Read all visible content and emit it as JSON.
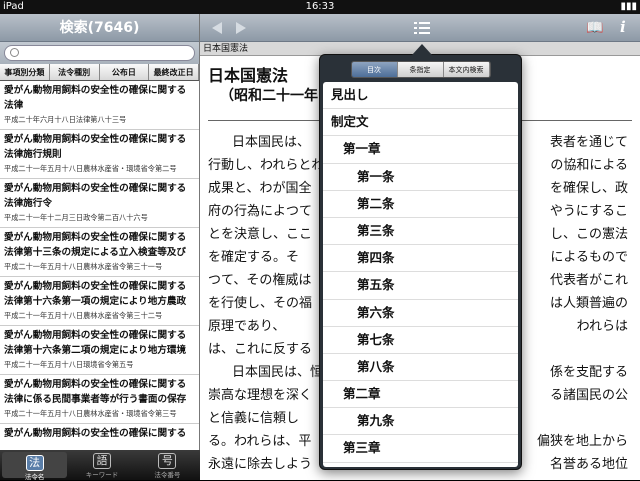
{
  "status": {
    "device": "iPad",
    "time": "16:33",
    "battery": "⎕"
  },
  "left": {
    "title": "検索(7646)",
    "search_placeholder": "",
    "segments": [
      "事項別分類",
      "法令種別",
      "公布日",
      "最終改正日"
    ],
    "items": [
      {
        "title": "愛がん動物用飼料の安全性の確保に関する法律",
        "title2": "",
        "sub": "平成二十年六月十八日法律第八十三号"
      },
      {
        "title": "愛がん動物用飼料の安全性の確保に関する法律施行規則",
        "sub": "平成二十一年五月十八日農林水産省・環境省令第二号"
      },
      {
        "title": "愛がん動物用飼料の安全性の確保に関する法律施行令",
        "sub": "平成二十一年十二月三日政令第二百八十六号"
      },
      {
        "title": "愛がん動物用飼料の安全性の確保に関する法律第十三条の規定による立入検査等及び",
        "sub": "平成二十一年五月十八日農林水産省令第三十一号"
      },
      {
        "title": "愛がん動物用飼料の安全性の確保に関する法律第十六条第一項の規定により地方農政",
        "sub": "平成二十一年五月十八日農林水産省令第三十二号"
      },
      {
        "title": "愛がん動物用飼料の安全性の確保に関する法律第十六条第二項の規定により地方環境",
        "sub": "平成二十一年五月十八日環境省令第五号"
      },
      {
        "title": "愛がん動物用飼料の安全性の確保に関する法律に係る民間事業者等が行う書面の保存",
        "sub": "平成二十一年五月十八日農林水産省・環境省令第三号"
      },
      {
        "title": "愛がん動物用飼料の安全性の確保に関する",
        "sub": ""
      }
    ],
    "tabs": [
      {
        "icon": "法",
        "label": "法令名",
        "selected": true
      },
      {
        "icon": "語",
        "label": "キーワード",
        "selected": false
      },
      {
        "icon": "号",
        "label": "法令番号",
        "selected": false
      }
    ]
  },
  "right": {
    "breadcrumb": "日本国憲法",
    "doc_title": "日本国憲法",
    "doc_subtitle": "（昭和二十一年",
    "paragraphs": [
      "日本国民は、",
      "行動し、われらとわ",
      "成果と、わが国全",
      "府の行為によつて",
      "とを決意し、ここ",
      "を確定する。そ",
      "つて、その権威は",
      "を行使し、その福",
      "原理であり、",
      "は、これに反する",
      "日本国民は、恒",
      "崇高な理想を深く",
      "と信義に信頼し",
      "る。われらは、平",
      "永遠に除去しよう"
    ],
    "paragraphs_right": [
      "表者を通じて",
      "の協和による",
      "を確保し、政",
      "やうにするこ",
      "し、この憲法",
      "によるもので",
      "代表者がこれ",
      "は人類普遍の",
      "われらは",
      "",
      "係を支配する",
      "る諸国民の公",
      "",
      "偏狭を地上から",
      "名誉ある地位"
    ]
  },
  "popover": {
    "segments": [
      {
        "label": "目次",
        "selected": true
      },
      {
        "label": "条指定",
        "selected": false
      },
      {
        "label": "本文内検索",
        "selected": false
      }
    ],
    "toc": [
      {
        "label": "見出し",
        "level": 0
      },
      {
        "label": "制定文",
        "level": 0
      },
      {
        "label": "第一章",
        "level": 1
      },
      {
        "label": "第一条",
        "level": 2
      },
      {
        "label": "第二条",
        "level": 2
      },
      {
        "label": "第三条",
        "level": 2
      },
      {
        "label": "第四条",
        "level": 2
      },
      {
        "label": "第五条",
        "level": 2
      },
      {
        "label": "第六条",
        "level": 2
      },
      {
        "label": "第七条",
        "level": 2
      },
      {
        "label": "第八条",
        "level": 2
      },
      {
        "label": "第二章",
        "level": 1
      },
      {
        "label": "第九条",
        "level": 2
      },
      {
        "label": "第三章",
        "level": 1
      }
    ]
  }
}
